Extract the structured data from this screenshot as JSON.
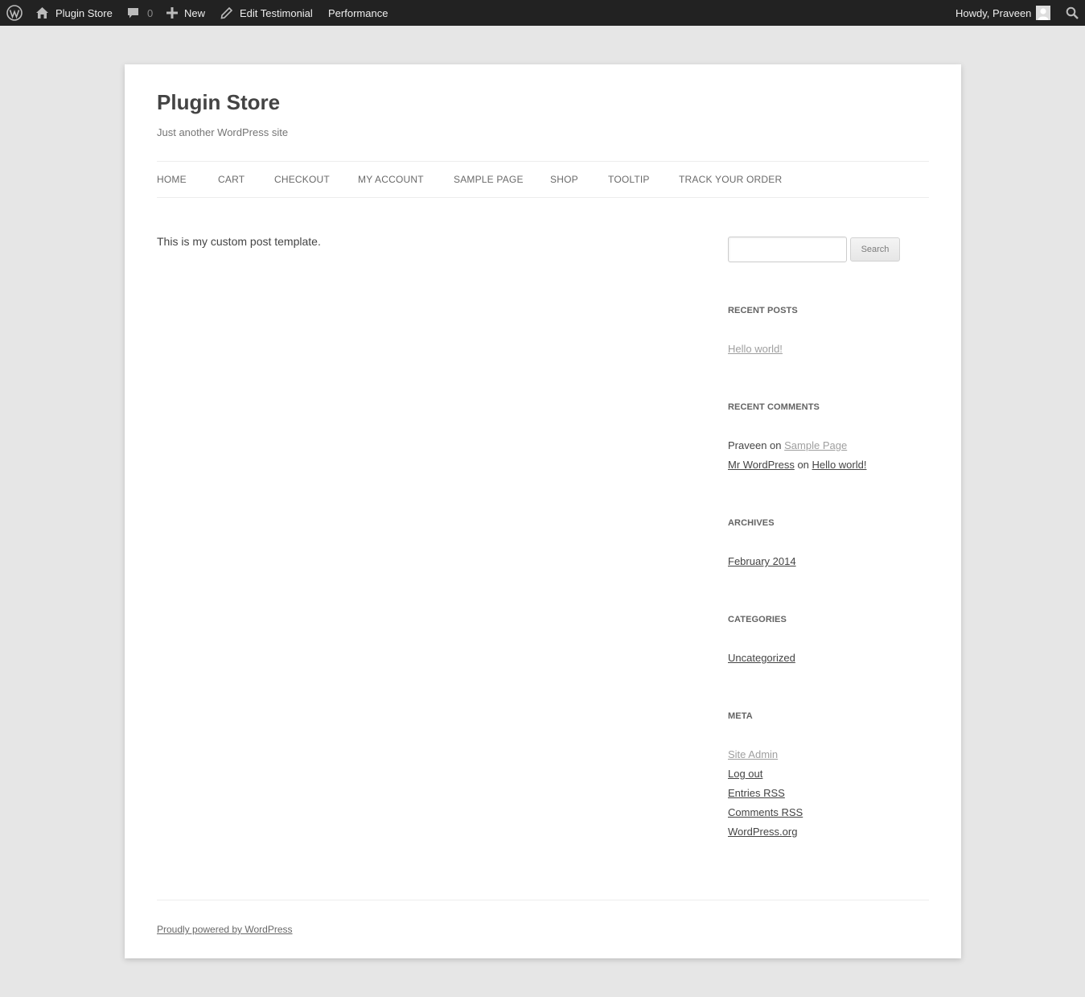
{
  "adminbar": {
    "wp_logo_icon": "wordpress-logo-icon",
    "site_name": "Plugin Store",
    "comments_count": "0",
    "new_label": "New",
    "edit_label": "Edit Testimonial",
    "performance_label": "Performance",
    "howdy": "Howdy, Praveen",
    "search_icon": "search-icon"
  },
  "header": {
    "title": "Plugin Store",
    "description": "Just another WordPress site"
  },
  "nav": {
    "items": [
      "HOME",
      "CART",
      "CHECKOUT",
      "MY ACCOUNT",
      "SAMPLE PAGE",
      "SHOP",
      "TOOLTIP",
      "TRACK YOUR ORDER"
    ]
  },
  "content": {
    "text": "This is my custom post template."
  },
  "sidebar": {
    "search": {
      "button_label": "Search",
      "value": ""
    },
    "recent_posts": {
      "title": "RECENT POSTS",
      "items": [
        "Hello world!"
      ]
    },
    "recent_comments": {
      "title": "RECENT COMMENTS",
      "items": [
        {
          "author": "Praveen",
          "connector": "on",
          "post": "Sample Page"
        },
        {
          "author": "Mr WordPress",
          "connector": "on",
          "post": "Hello world!"
        }
      ]
    },
    "archives": {
      "title": "ARCHIVES",
      "items": [
        "February 2014"
      ]
    },
    "categories": {
      "title": "CATEGORIES",
      "items": [
        "Uncategorized"
      ]
    },
    "meta": {
      "title": "META",
      "items": [
        "Site Admin",
        "Log out",
        "Entries RSS",
        "Comments RSS",
        "WordPress.org"
      ]
    }
  },
  "footer": {
    "credit": "Proudly powered by WordPress"
  },
  "colors": {
    "adminbar_bg": "#222222",
    "page_bg": "#e6e6e6",
    "card_bg": "#ffffff",
    "visited_link": "#9f9f9f"
  }
}
